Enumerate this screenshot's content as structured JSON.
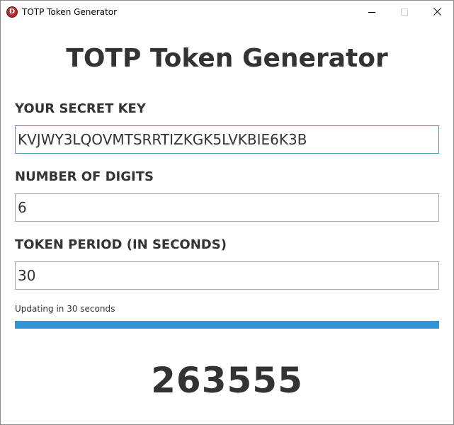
{
  "window": {
    "title": "TOTP Token Generator",
    "icon_letter": "D",
    "controls": [
      "minimize-icon",
      "maximize-icon",
      "close-icon"
    ]
  },
  "app": {
    "heading": "TOTP Token Generator"
  },
  "fields": {
    "secret": {
      "label": "YOUR SECRET KEY",
      "value": "KVJWY3LQOVMTSRRTIZKGK5LVKBIE6K3B"
    },
    "digits": {
      "label": "NUMBER OF DIGITS",
      "value": "6"
    },
    "period": {
      "label": "TOKEN PERIOD (IN SECONDS)",
      "value": "30"
    }
  },
  "status": {
    "text": "Updating in 30 seconds",
    "progress_fraction": 1.0
  },
  "token": {
    "value": "263555"
  },
  "colors": {
    "accent": "#2f93d6",
    "text": "#333333",
    "focus_border": "#4a9ab5",
    "app_icon": "#b3282d"
  }
}
